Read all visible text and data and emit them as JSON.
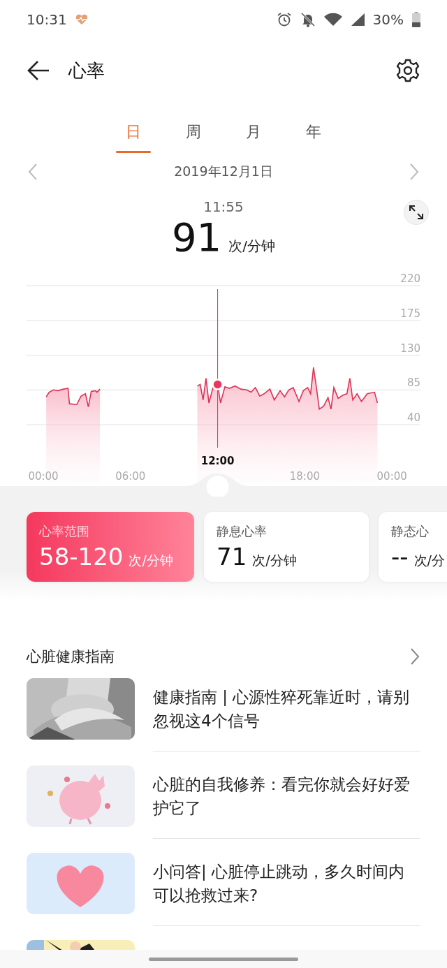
{
  "status_bar": {
    "time": "10:31",
    "battery": "30%"
  },
  "header": {
    "title": "心率"
  },
  "tabs": [
    {
      "label": "日",
      "selected": true
    },
    {
      "label": "周",
      "selected": false
    },
    {
      "label": "月",
      "selected": false
    },
    {
      "label": "年",
      "selected": false
    }
  ],
  "date": "2019年12月1日",
  "reading": {
    "time": "11:55",
    "value": "91",
    "unit": "次/分钟"
  },
  "chart": {
    "chart_data": {
      "type": "area",
      "grid": true,
      "xlim": [
        0,
        24
      ],
      "ylim": [
        40,
        220
      ],
      "x": [
        0.2,
        0.4,
        0.7,
        1.0,
        1.4,
        1.7,
        1.8,
        2.3,
        2.6,
        2.9,
        3.1,
        3.3,
        3.6,
        3.7,
        3.9,
        4.0,
        10.6,
        10.8,
        11.0,
        11.2,
        11.4,
        11.7,
        12.0,
        12.2,
        12.5,
        12.8,
        13.2,
        13.6,
        14.0,
        14.3,
        14.6,
        14.9,
        15.2,
        15.6,
        15.9,
        16.3,
        16.6,
        16.9,
        17.2,
        17.6,
        17.9,
        18.2,
        18.4,
        18.6,
        18.8,
        19.0,
        19.3,
        19.6,
        19.8,
        20.0,
        20.3,
        20.6,
        20.9,
        21.1,
        21.3,
        21.6,
        21.9,
        22.3,
        22.8,
        23.0
      ],
      "values": [
        76,
        82,
        85,
        84,
        86,
        87,
        67,
        66,
        77,
        80,
        63,
        83,
        84,
        82,
        86,
        null,
        90,
        92,
        72,
        100,
        68,
        89,
        92,
        68,
        89,
        87,
        90,
        86,
        85,
        82,
        88,
        77,
        80,
        86,
        72,
        84,
        76,
        85,
        88,
        70,
        84,
        88,
        80,
        114,
        88,
        60,
        64,
        75,
        60,
        88,
        74,
        78,
        80,
        100,
        72,
        80,
        70,
        80,
        82,
        68
      ],
      "yticks": [
        40,
        85,
        130,
        175,
        220
      ],
      "xticks": [
        {
          "value": 0,
          "label": "00:00"
        },
        {
          "value": 6,
          "label": "06:00"
        },
        {
          "value": 18,
          "label": "18:00"
        },
        {
          "value": 24,
          "label": "00:00"
        }
      ],
      "ref_lines": [
        {
          "axis": "x",
          "value": 12
        }
      ],
      "annotations": [
        "12:00"
      ]
    }
  },
  "cards": [
    {
      "label": "心率范围",
      "value": "58-120",
      "unit": "次/分钟",
      "selected": true
    },
    {
      "label": "静息心率",
      "value": "71",
      "unit": "次/分钟",
      "selected": false
    },
    {
      "label": "静态心",
      "value": "--",
      "unit": "次/分",
      "selected": false
    }
  ],
  "guide": {
    "title": "心脏健康指南"
  },
  "articles": [
    {
      "title": "健康指南 | 心源性猝死靠近时，请别忽视这4个信号",
      "thumbnail": {
        "kind": "picture"
      }
    },
    {
      "title": "心脏的自我修养：看完你就会好好爱护它了",
      "thumbnail": {
        "kind": "picture"
      }
    },
    {
      "title": "小问答| 心脏停止跳动，多久时间内可以抢救过来?",
      "thumbnail": {
        "kind": "picture"
      }
    },
    {
      "thumbnail": {
        "kind": "picture"
      }
    }
  ]
}
